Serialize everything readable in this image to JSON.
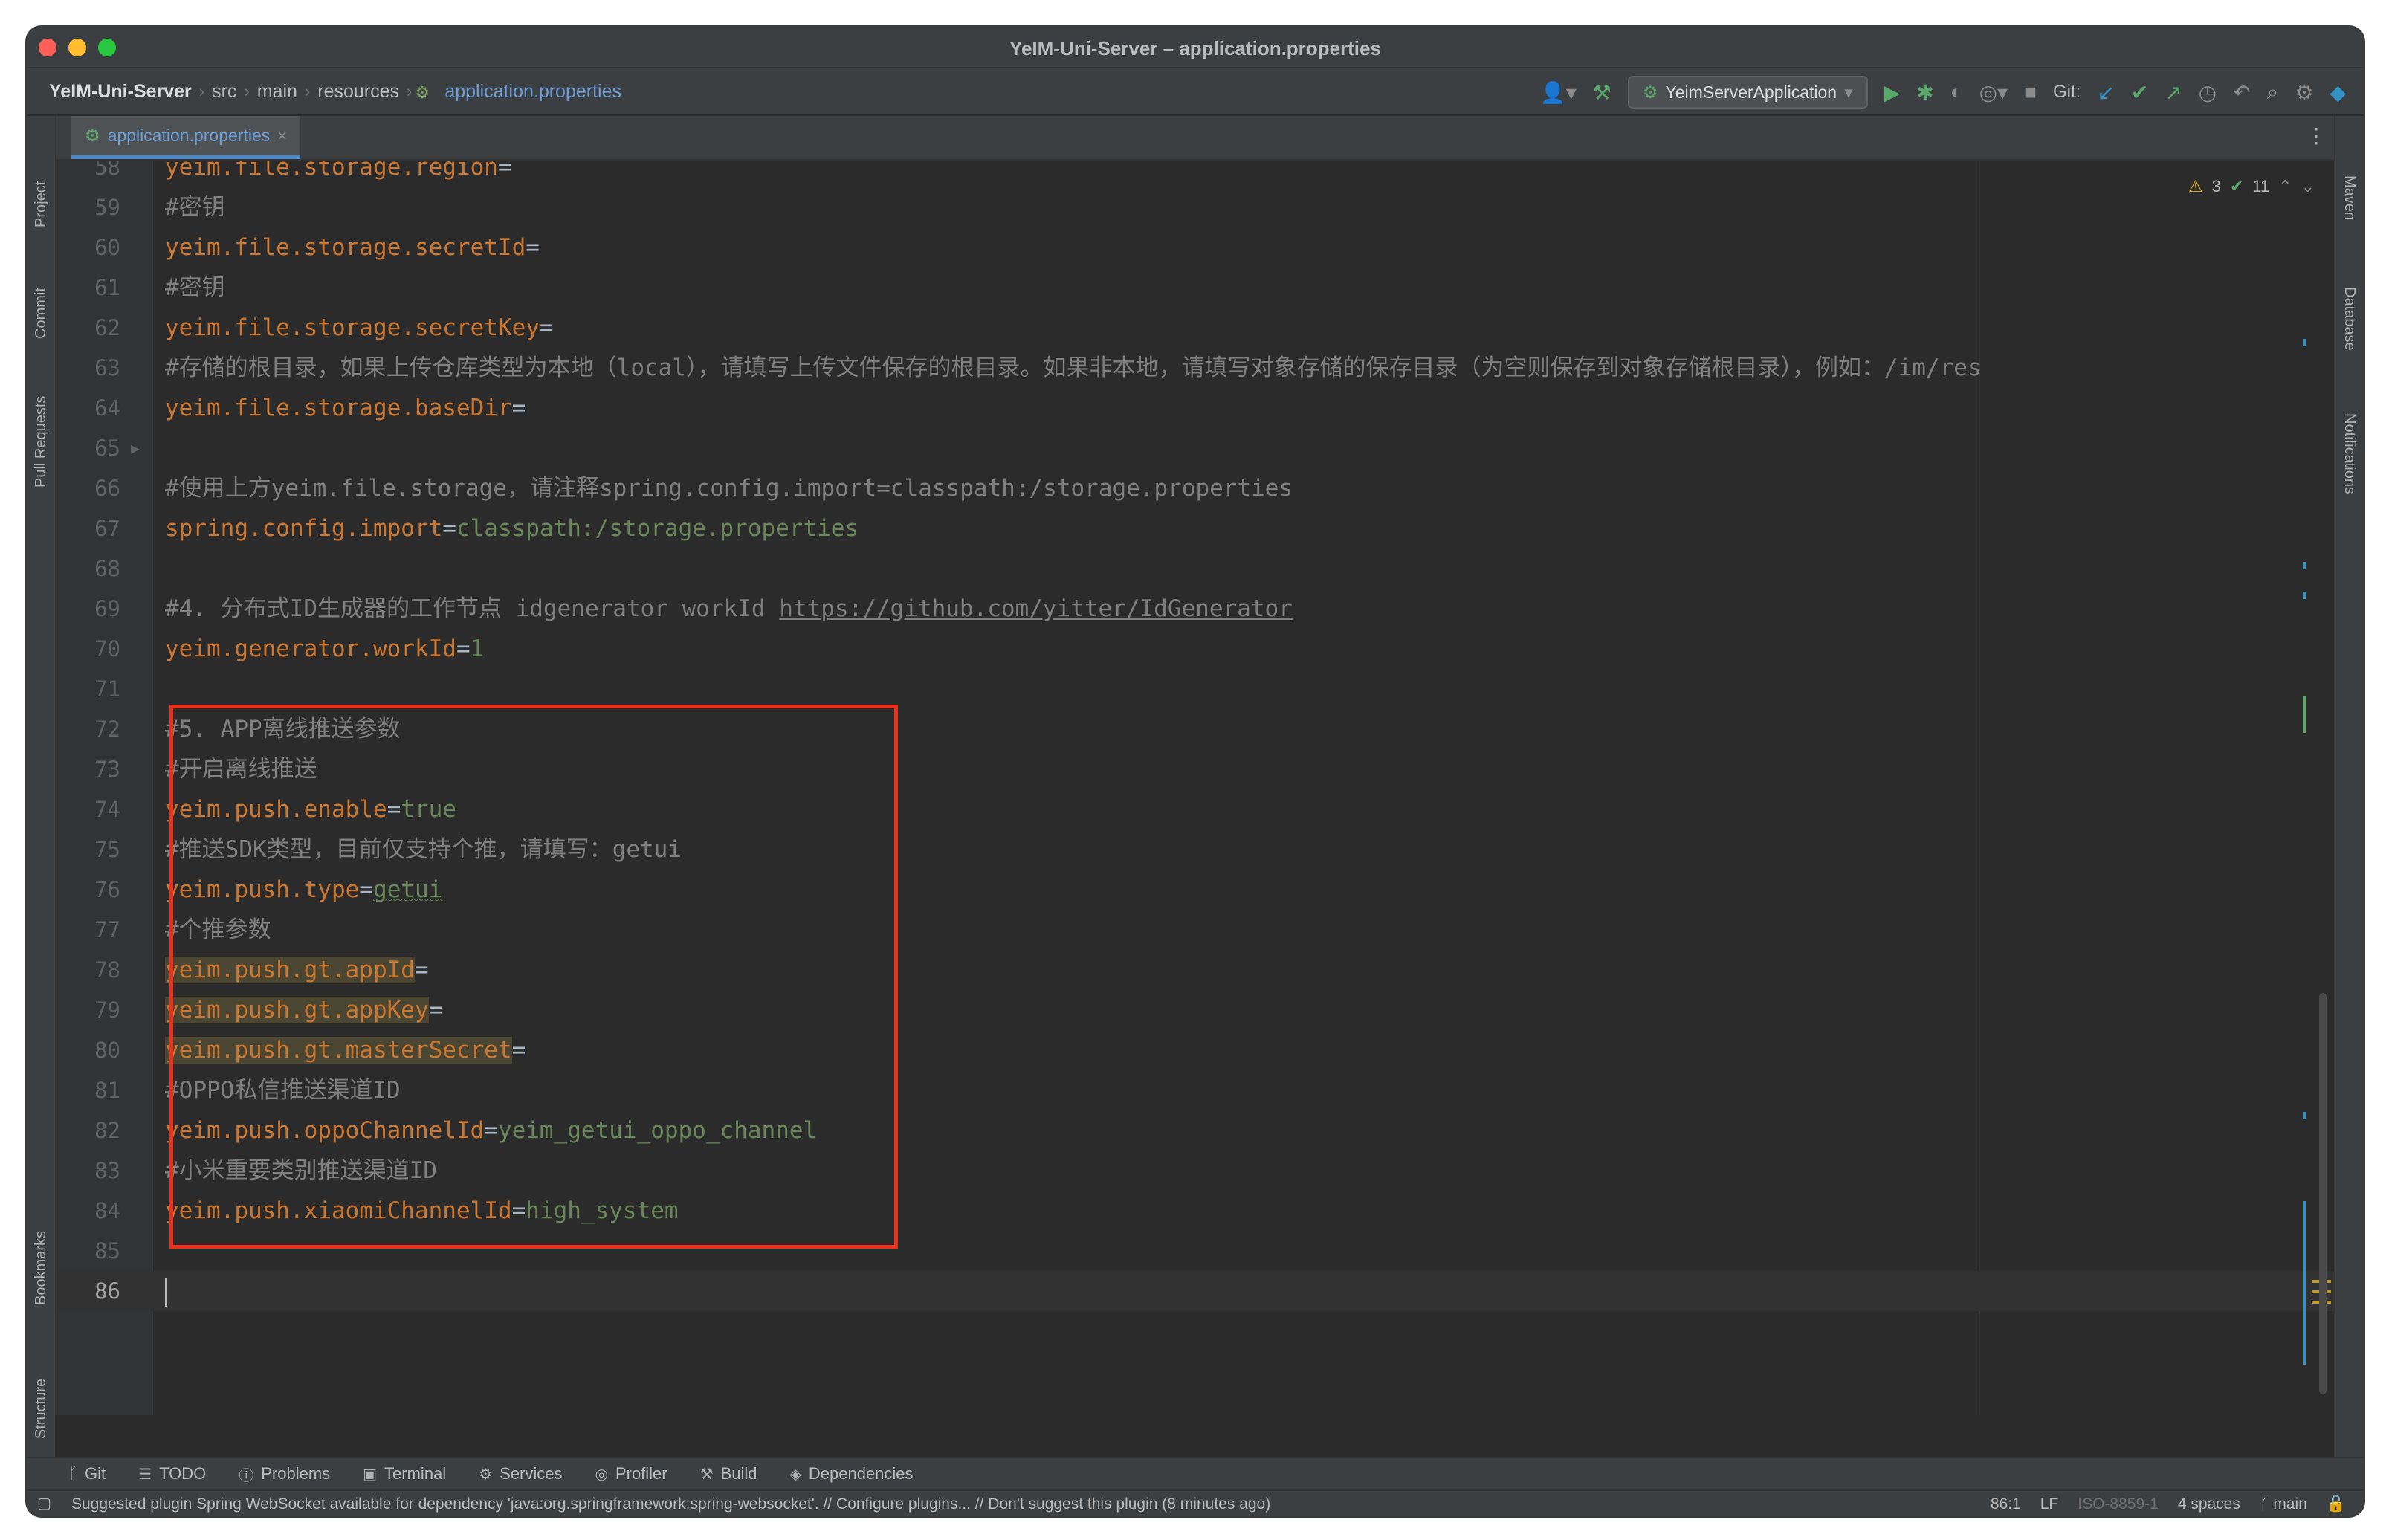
{
  "window": {
    "title": "YeIM-Uni-Server – application.properties"
  },
  "breadcrumb": {
    "project": "YeIM-Uni-Server",
    "items": [
      "src",
      "main",
      "resources"
    ],
    "file": "application.properties"
  },
  "toolbar": {
    "run_config": "YeimServerApplication",
    "git_label": "Git:"
  },
  "tabs": [
    {
      "label": "application.properties"
    }
  ],
  "left_tools": [
    "Project",
    "Commit",
    "Pull Requests",
    "Bookmarks",
    "Structure"
  ],
  "right_tools": [
    "Maven",
    "Database",
    "Notifications"
  ],
  "inspections": {
    "warnings": "3",
    "ok": "11"
  },
  "editor": {
    "lines": [
      {
        "num": "58",
        "type": "kv",
        "key": "yeim.file.storage.region",
        "value": ""
      },
      {
        "num": "59",
        "type": "comment",
        "text": "#密钥"
      },
      {
        "num": "60",
        "type": "kv",
        "key": "yeim.file.storage.secretId",
        "value": ""
      },
      {
        "num": "61",
        "type": "comment",
        "text": "#密钥"
      },
      {
        "num": "62",
        "type": "kv",
        "key": "yeim.file.storage.secretKey",
        "value": ""
      },
      {
        "num": "63",
        "type": "comment",
        "text": "#存储的根目录，如果上传仓库类型为本地（local），请填写上传文件保存的根目录。如果非本地，请填写对象存储的保存目录（为空则保存到对象存储根目录），例如：/im/res"
      },
      {
        "num": "64",
        "type": "kv",
        "key": "yeim.file.storage.baseDir",
        "value": ""
      },
      {
        "num": "65",
        "type": "blank"
      },
      {
        "num": "66",
        "type": "comment",
        "text": "#使用上方yeim.file.storage，请注释spring.config.import=classpath:/storage.properties"
      },
      {
        "num": "67",
        "type": "kv",
        "key": "spring.config.import",
        "value": "classpath:/storage.properties"
      },
      {
        "num": "68",
        "type": "blank"
      },
      {
        "num": "69",
        "type": "comment_link",
        "text": "#4. 分布式ID生成器的工作节点 idgenerator workId ",
        "link": "https://github.com/yitter/IdGenerator"
      },
      {
        "num": "70",
        "type": "kv",
        "key": "yeim.generator.workId",
        "value": "1"
      },
      {
        "num": "71",
        "type": "blank"
      },
      {
        "num": "72",
        "type": "comment",
        "text": "#5. APP离线推送参数"
      },
      {
        "num": "73",
        "type": "comment",
        "text": "#开启离线推送"
      },
      {
        "num": "74",
        "type": "kv",
        "key": "yeim.push.enable",
        "value": "true"
      },
      {
        "num": "75",
        "type": "comment",
        "text": "#推送SDK类型，目前仅支持个推，请填写：getui"
      },
      {
        "num": "76",
        "type": "kv",
        "key": "yeim.push.type",
        "value": "getui",
        "squiggle": true
      },
      {
        "num": "77",
        "type": "comment",
        "text": "#个推参数"
      },
      {
        "num": "78",
        "type": "kv",
        "key": "yeim.push.gt.appId",
        "value": "",
        "highlight": true
      },
      {
        "num": "79",
        "type": "kv",
        "key": "yeim.push.gt.appKey",
        "value": "",
        "highlight": true
      },
      {
        "num": "80",
        "type": "kv",
        "key": "yeim.push.gt.masterSecret",
        "value": "",
        "highlight": true
      },
      {
        "num": "81",
        "type": "comment",
        "text": "#OPPO私信推送渠道ID"
      },
      {
        "num": "82",
        "type": "kv",
        "key": "yeim.push.oppoChannelId",
        "value": "yeim_getui_oppo_channel"
      },
      {
        "num": "83",
        "type": "comment",
        "text": "#小米重要类别推送渠道ID"
      },
      {
        "num": "84",
        "type": "kv",
        "key": "yeim.push.xiaomiChannelId",
        "value": "high_system"
      },
      {
        "num": "85",
        "type": "blank"
      },
      {
        "num": "86",
        "type": "caret"
      }
    ]
  },
  "bottom_tools": [
    "Git",
    "TODO",
    "Problems",
    "Terminal",
    "Services",
    "Profiler",
    "Build",
    "Dependencies"
  ],
  "status": {
    "message": "Suggested plugin Spring WebSocket available for dependency 'java:org.springframework:spring-websocket'. // Configure plugins... // Don't suggest this plugin (8 minutes ago)",
    "position": "86:1",
    "line_sep": "LF",
    "encoding": "ISO-8859-1",
    "indent": "4 spaces",
    "branch": "main"
  },
  "colors": {
    "key": "#cc7832",
    "value": "#6a8759",
    "comment": "#808080",
    "annotation_box": "#e8321e"
  }
}
